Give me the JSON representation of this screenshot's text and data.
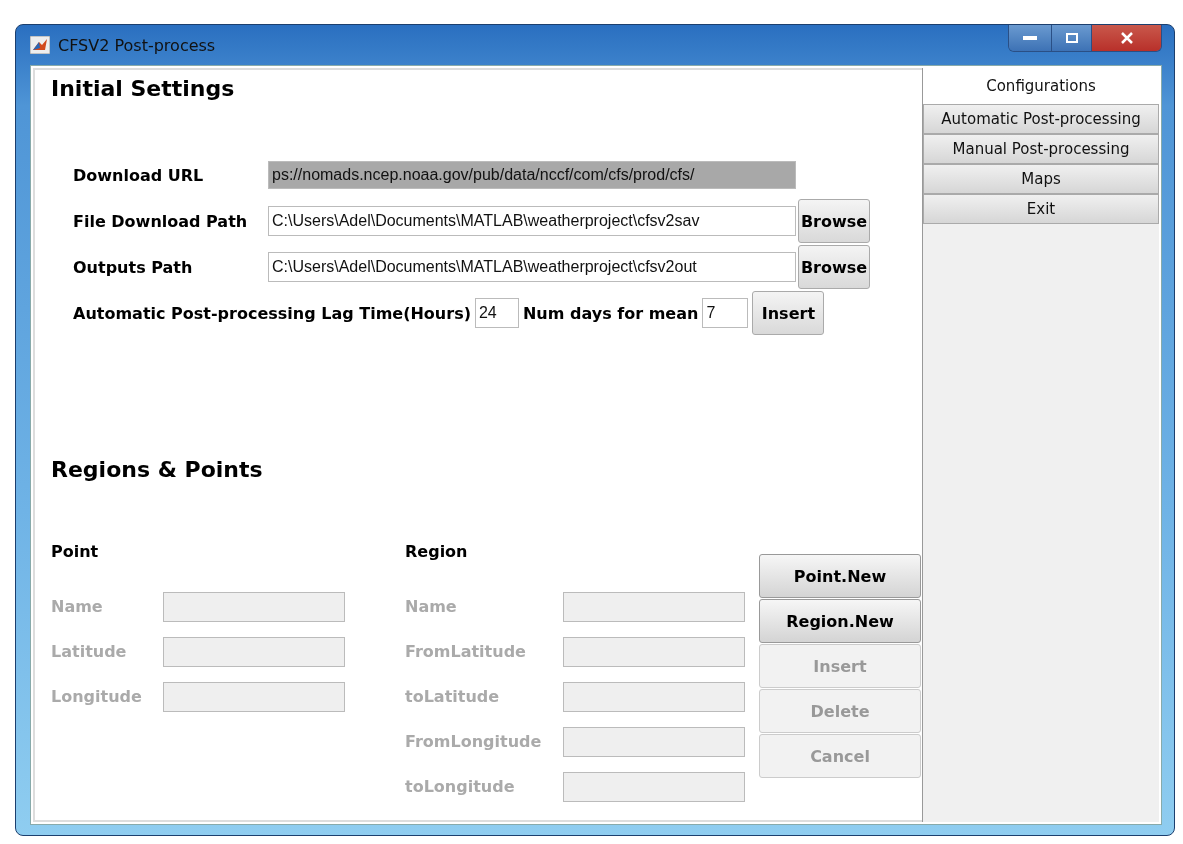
{
  "window": {
    "title": "CFSV2 Post-process"
  },
  "initial_settings": {
    "heading": "Initial Settings",
    "rows": [
      {
        "kind": "url",
        "label": "Download URL",
        "value": "ps://nomads.ncep.noaa.gov/pub/data/nccf/com/cfs/prod/cfs/"
      },
      {
        "kind": "path",
        "label": "File Download Path",
        "value": "C:\\Users\\Adel\\Documents\\MATLAB\\weatherproject\\cfsv2sav",
        "button": "Browse"
      },
      {
        "kind": "path",
        "label": "Outputs Path",
        "value": "C:\\Users\\Adel\\Documents\\MATLAB\\weatherproject\\cfsv2out",
        "button": "Browse"
      }
    ],
    "lag_label": "Automatic Post-processing Lag Time(Hours)",
    "lag_value": "24",
    "days_label": "Num days for mean",
    "days_value": "7",
    "insert_button": "Insert"
  },
  "regions_points": {
    "heading": "Regions & Points",
    "point": {
      "title": "Point",
      "fields": [
        {
          "label": "Name",
          "disabled": true
        },
        {
          "label": "Latitude",
          "disabled": true
        },
        {
          "label": "Longitude",
          "disabled": true
        }
      ]
    },
    "region": {
      "title": "Region",
      "fields": [
        {
          "label": "Name",
          "disabled": true
        },
        {
          "label": "FromLatitude",
          "disabled": true
        },
        {
          "label": "toLatitude",
          "disabled": true
        },
        {
          "label": "FromLongitude",
          "disabled": true
        },
        {
          "label": "toLongitude",
          "disabled": true
        }
      ]
    },
    "buttons": [
      {
        "label": "Point.New",
        "disabled": false
      },
      {
        "label": "Region.New",
        "disabled": false
      },
      {
        "label": "Insert",
        "disabled": true
      },
      {
        "label": "Delete",
        "disabled": true
      },
      {
        "label": "Cancel",
        "disabled": true
      }
    ]
  },
  "tabs": [
    {
      "label": "Configurations",
      "selected": true
    },
    {
      "label": "Automatic Post-processing",
      "selected": false
    },
    {
      "label": "Manual Post-processing",
      "selected": false
    },
    {
      "label": "Maps",
      "selected": false
    },
    {
      "label": "Exit",
      "selected": false
    }
  ]
}
